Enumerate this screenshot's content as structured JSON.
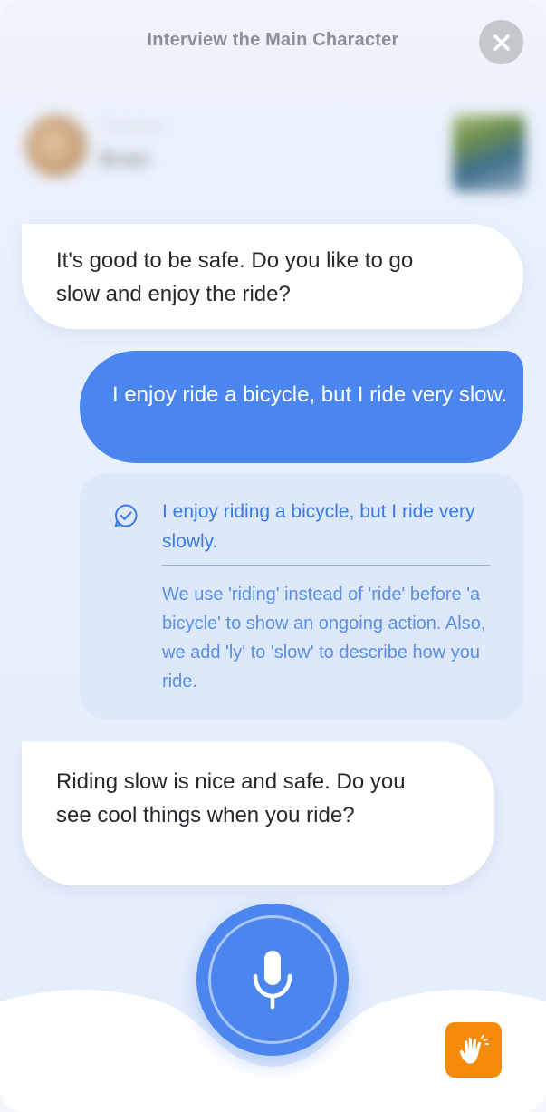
{
  "header": {
    "title": "Interview the Main Character",
    "close_icon": "close-icon"
  },
  "character": {
    "subtitle": "Character",
    "name": "Brain"
  },
  "messages": {
    "ai_1": "It's good to be safe. Do you like to go slow and enjoy the ride?",
    "user_1": "I enjoy ride a bicycle, but I ride very slow.",
    "correction": {
      "icon": "check-circle-icon",
      "corrected": "I enjoy riding a bicycle, but I ride very slowly.",
      "explanation": "We use 'riding' instead of 'ride' before 'a bicycle' to show an ongoing action. Also, we add 'ly' to 'slow' to describe how you ride."
    },
    "ai_2": "Riding slow is nice and safe. Do you see cool things when you ride?"
  },
  "controls": {
    "mic_icon": "microphone-icon",
    "hand_icon": "raise-hand-icon"
  },
  "colors": {
    "accent": "#4a86ee",
    "correction_bg": "#dde8fb",
    "hand_button": "#f58a0b"
  }
}
